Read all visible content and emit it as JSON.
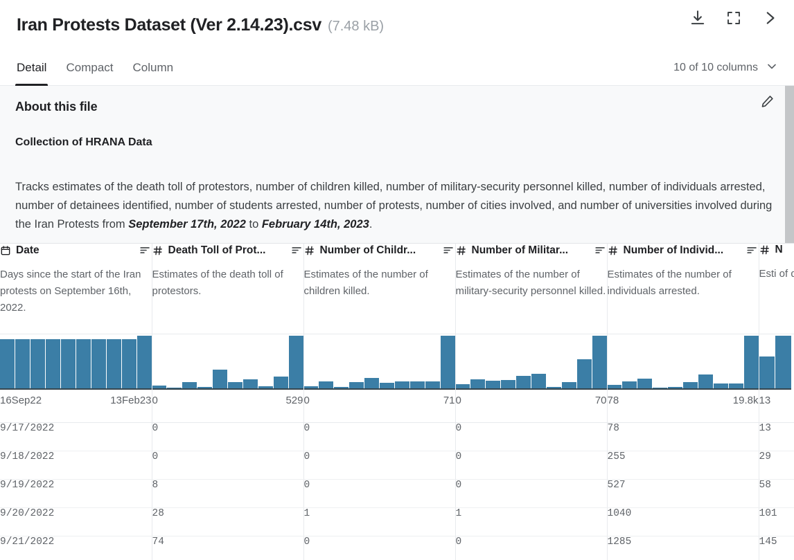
{
  "header": {
    "file_title": "Iran Protests Dataset (Ver 2.14.23).csv",
    "file_size": "(7.48 kB)",
    "actions": [
      {
        "name": "download-icon",
        "label": "Download"
      },
      {
        "name": "fullscreen-icon",
        "label": "Fullscreen"
      },
      {
        "name": "chevron-right-icon",
        "label": "Next"
      }
    ]
  },
  "tabs": {
    "items": [
      {
        "label": "Detail",
        "active": true
      },
      {
        "label": "Compact",
        "active": false
      },
      {
        "label": "Column",
        "active": false
      }
    ],
    "column_count_label": "10 of 10 columns"
  },
  "about": {
    "heading": "About this file",
    "subheading": "Collection of HRANA Data",
    "description_part1": "Tracks estimates of the death toll of protestors, number of children killed, number of military-security personnel killed, number of individuals arrested, number of detainees identified, number of students arrested, number of protests, number of cities involved, and number of universities involved during the Iran Protests from ",
    "date_start": "September 17th, 2022",
    "description_mid": " to ",
    "date_end": "February 14th, 2023",
    "description_end": ".",
    "edit_label": "Edit"
  },
  "columns": [
    {
      "name": "Date",
      "type_icon": "calendar-icon",
      "description": "Days since the start of the Iran protests on September 16th, 2022."
    },
    {
      "name": "Death Toll of Prot...",
      "type_icon": "hash-icon",
      "description": "Estimates of the death toll of protestors."
    },
    {
      "name": "Number of Childr...",
      "type_icon": "hash-icon",
      "description": "Estimates of the number of children killed."
    },
    {
      "name": "Number of Militar...",
      "type_icon": "hash-icon",
      "description": "Estimates of the number of military-security personnel killed."
    },
    {
      "name": "Number of Individ...",
      "type_icon": "hash-icon",
      "description": "Estimates of the number of individuals arrested."
    },
    {
      "name": "N",
      "type_icon": "hash-icon",
      "description": "Esti of d"
    }
  ],
  "chart_data": [
    {
      "type": "bar",
      "title": "Date",
      "xlabel": "",
      "ylabel": "count",
      "min_label": "16Sep22",
      "max_label": "13Feb23",
      "categories": [
        "b1",
        "b2",
        "b3",
        "b4",
        "b5",
        "b6",
        "b7",
        "b8",
        "b9",
        "b10"
      ],
      "values": [
        93,
        93,
        93,
        93,
        93,
        93,
        93,
        93,
        93,
        100
      ]
    },
    {
      "type": "bar",
      "title": "Death Toll of Protestors",
      "xlabel": "",
      "ylabel": "count",
      "min_label": "0",
      "max_label": "529",
      "categories": [
        "b1",
        "b2",
        "b3",
        "b4",
        "b5",
        "b6",
        "b7",
        "b8",
        "b9",
        "b10"
      ],
      "values": [
        5,
        1,
        12,
        2,
        36,
        12,
        17,
        4,
        23,
        100
      ]
    },
    {
      "type": "bar",
      "title": "Number of Children Killed",
      "xlabel": "",
      "ylabel": "count",
      "min_label": "0",
      "max_label": "71",
      "categories": [
        "b1",
        "b2",
        "b3",
        "b4",
        "b5",
        "b6",
        "b7",
        "b8",
        "b9",
        "b10"
      ],
      "values": [
        4,
        13,
        2,
        12,
        20,
        10,
        13,
        13,
        13,
        100
      ]
    },
    {
      "type": "bar",
      "title": "Number of Military-Security Personnel Killed",
      "xlabel": "",
      "ylabel": "count",
      "min_label": "0",
      "max_label": "70",
      "categories": [
        "b1",
        "b2",
        "b3",
        "b4",
        "b5",
        "b6",
        "b7",
        "b8",
        "b9",
        "b10"
      ],
      "values": [
        8,
        17,
        14,
        16,
        24,
        28,
        2,
        12,
        55,
        100
      ]
    },
    {
      "type": "bar",
      "title": "Number of Individuals Arrested",
      "xlabel": "",
      "ylabel": "count",
      "min_label": "78",
      "max_label": "19.8k",
      "categories": [
        "b1",
        "b2",
        "b3",
        "b4",
        "b5",
        "b6",
        "b7",
        "b8",
        "b9",
        "b10"
      ],
      "values": [
        7,
        13,
        19,
        1,
        3,
        12,
        26,
        9,
        9,
        100
      ]
    },
    {
      "type": "bar",
      "title": "Number of Detainees Identified",
      "xlabel": "",
      "ylabel": "count",
      "min_label": "13",
      "max_label": "",
      "categories": [
        "b1",
        "b2"
      ],
      "values": [
        48,
        80
      ]
    }
  ],
  "table": {
    "rows": [
      {
        "cells": [
          "9/17/2022",
          "0",
          "0",
          "0",
          "78",
          "13"
        ]
      },
      {
        "cells": [
          "9/18/2022",
          "0",
          "0",
          "0",
          "255",
          "29"
        ]
      },
      {
        "cells": [
          "9/19/2022",
          "8",
          "0",
          "0",
          "527",
          "58"
        ]
      },
      {
        "cells": [
          "9/20/2022",
          "28",
          "1",
          "1",
          "1040",
          "101"
        ]
      },
      {
        "cells": [
          "9/21/2022",
          "74",
          "0",
          "0",
          "1285",
          "145"
        ]
      }
    ]
  }
}
